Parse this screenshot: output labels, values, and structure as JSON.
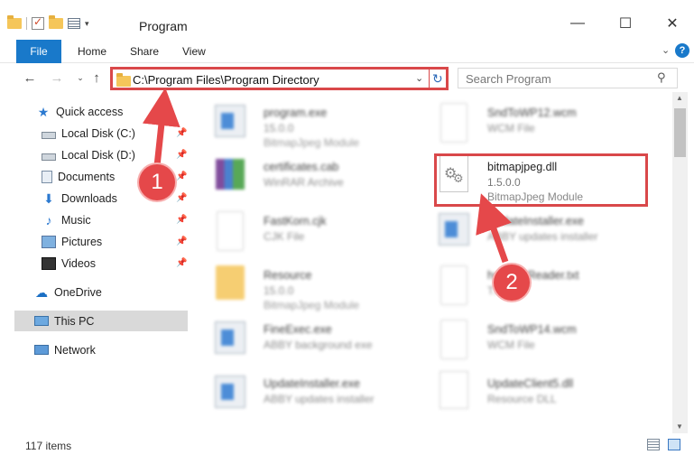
{
  "window": {
    "title": "Program",
    "minimize_glyph": "—",
    "maximize_glyph": "☐",
    "close_glyph": "✕"
  },
  "ribbon": {
    "tabs": [
      "File",
      "Home",
      "Share",
      "View"
    ],
    "chevron": "⌄",
    "help": "?"
  },
  "navigation": {
    "back": "←",
    "forward": "→",
    "recent": "⌄",
    "up": "↑",
    "address": "C:\\Program Files\\Program Directory",
    "address_dropdown": "⌄",
    "refresh": "↻",
    "search_placeholder": "Search Program",
    "search_icon": "⚲"
  },
  "sidebar": {
    "items": [
      {
        "label": "Quick access",
        "icon": "star-icon"
      },
      {
        "label": "Local Disk (C:)",
        "icon": "drive-icon",
        "pinned": true
      },
      {
        "label": "Local Disk (D:)",
        "icon": "drive-icon",
        "pinned": true
      },
      {
        "label": "Documents",
        "icon": "documents-icon",
        "pinned": true
      },
      {
        "label": "Downloads",
        "icon": "downloads-icon",
        "pinned": true
      },
      {
        "label": "Music",
        "icon": "music-icon",
        "pinned": true
      },
      {
        "label": "Pictures",
        "icon": "pictures-icon",
        "pinned": true
      },
      {
        "label": "Videos",
        "icon": "videos-icon",
        "pinned": true
      },
      {
        "label": "OneDrive",
        "icon": "onedrive-icon"
      },
      {
        "label": "This PC",
        "icon": "pc-icon",
        "selected": true
      },
      {
        "label": "Network",
        "icon": "network-icon"
      }
    ]
  },
  "files": [
    {
      "name": "program.exe",
      "line2": "15.0.0",
      "line3": "BitmapJpeg Module"
    },
    {
      "name": "SndToWP12.wcm",
      "line2": "WCM File",
      "line3": ""
    },
    {
      "name": "certificates.cab",
      "line2": "WinRAR Archive",
      "line3": ""
    },
    {
      "name": "bitmapjpeg.dll",
      "line2": "1.5.0.0",
      "line3": "BitmapJpeg Module"
    },
    {
      "name": "FastKorn.cjk",
      "line2": "CJK File",
      "line3": ""
    },
    {
      "name": "UpdateInstaller.exe",
      "line2": "ABBY updates installer",
      "line3": ""
    },
    {
      "name": "Resource",
      "line2": "15.0.0",
      "line3": "BitmapJpeg Module"
    },
    {
      "name": "help",
      "line2": "TXT",
      "line3": ""
    },
    {
      "name": "Reader.txt",
      "line2": "",
      "line3": ""
    },
    {
      "name": "FineExec.exe",
      "line2": "ABBY background exe",
      "line3": ""
    },
    {
      "name": "SndToWP14.wcm",
      "line2": "WCM File",
      "line3": ""
    },
    {
      "name": "UpdateInstaller.exe",
      "line2": "ABBY updates installer",
      "line3": ""
    },
    {
      "name": "UpdateClient5.dll",
      "line2": "Resource DLL",
      "line3": ""
    }
  ],
  "status": {
    "item_count": "117 items"
  },
  "annotations": {
    "badge_1": "1",
    "badge_2": "2",
    "color": "#e5484a"
  },
  "colors": {
    "accent": "#1979ca",
    "highlight_border": "#d9484a",
    "selection": "#d9d9d9"
  }
}
